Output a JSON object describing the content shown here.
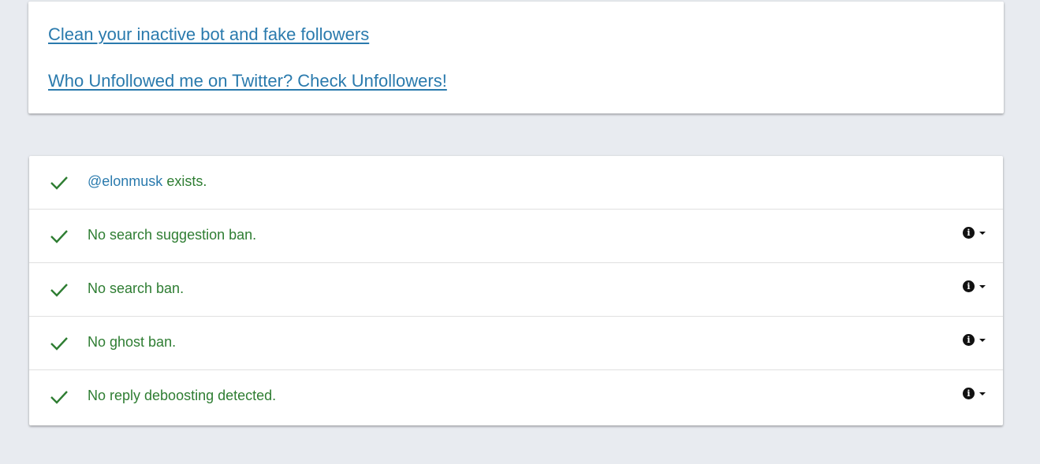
{
  "links": {
    "clean_followers": "Clean your inactive bot and fake followers",
    "unfollowers": "Who Unfollowed me on Twitter? Check Unfollowers!"
  },
  "results": [
    {
      "handle": "@elonmusk",
      "text": " exists.",
      "status": "pass",
      "has_info": false
    },
    {
      "text": "No search suggestion ban.",
      "status": "pass",
      "has_info": true
    },
    {
      "text": "No search ban.",
      "status": "pass",
      "has_info": true
    },
    {
      "text": "No ghost ban.",
      "status": "pass",
      "has_info": true
    },
    {
      "text": "No reply deboosting detected.",
      "status": "pass",
      "has_info": true
    }
  ],
  "icons": {
    "status": "check-icon",
    "info": "info-icon",
    "expand": "caret-down-icon"
  },
  "colors": {
    "link": "#2a7aad",
    "pass": "#2e7d32",
    "background": "#e8ebf0"
  }
}
